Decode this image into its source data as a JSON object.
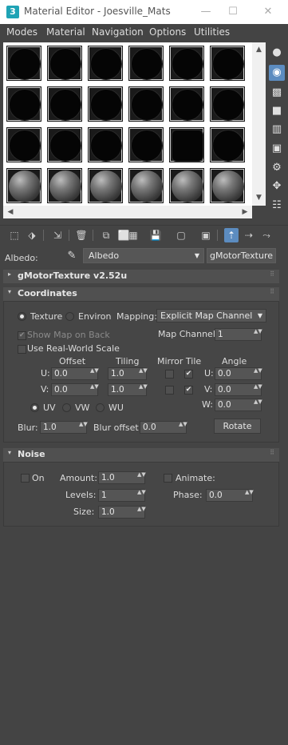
{
  "window": {
    "app_icon": "3",
    "title": "Material Editor - Joesville_Mats"
  },
  "menu": [
    "Modes",
    "Material",
    "Navigation",
    "Options",
    "Utilities"
  ],
  "slots": [
    [
      "black",
      "black",
      "black",
      "black",
      "black",
      "black"
    ],
    [
      "black",
      "black",
      "black",
      "black",
      "black",
      "black"
    ],
    [
      "black",
      "black",
      "black",
      "black",
      "black-square",
      "black"
    ],
    [
      "grey",
      "grey",
      "grey",
      "grey",
      "grey",
      "grey"
    ]
  ],
  "name_bar": {
    "label": "Albedo:",
    "material_name": "Albedo",
    "type_button": "gMotorTexture"
  },
  "rollouts": {
    "main": {
      "toggle": "▸",
      "title": "gMotorTexture v2.52u"
    },
    "coordinates": {
      "toggle": "▾",
      "title": "Coordinates",
      "texture_label": "Texture",
      "environ_label": "Environ",
      "mapping_label": "Mapping:",
      "mapping_value": "Explicit Map Channel",
      "show_map_on_back": "Show Map on Back",
      "map_channel_label": "Map Channel:",
      "map_channel_value": "1",
      "use_real_world_scale": "Use Real-World Scale",
      "col_offset": "Offset",
      "col_tiling": "Tiling",
      "col_mirror_tile": "Mirror Tile",
      "col_angle": "Angle",
      "u_label": "U:",
      "v_label": "V:",
      "w_label": "W:",
      "u_offset": "0.0",
      "v_offset": "0.0",
      "u_tiling": "1.0",
      "v_tiling": "1.0",
      "u_angle": "0.0",
      "v_angle": "0.0",
      "w_angle": "0.0",
      "uv_label": "UV",
      "vw_label": "VW",
      "wu_label": "WU",
      "blur_label": "Blur:",
      "blur_value": "1.0",
      "blur_offset_label": "Blur offset:",
      "blur_offset_value": "0.0",
      "rotate_button": "Rotate"
    },
    "noise": {
      "toggle": "▾",
      "title": "Noise",
      "on_label": "On",
      "amount_label": "Amount:",
      "amount_value": "1.0",
      "animate_label": "Animate:",
      "levels_label": "Levels:",
      "levels_value": "1",
      "phase_label": "Phase:",
      "phase_value": "0.0",
      "size_label": "Size:",
      "size_value": "1.0"
    }
  },
  "icons": {
    "close": "✕",
    "minimize": "—",
    "maximize": "☐",
    "scroll_up": "▲",
    "scroll_down": "▼",
    "scroll_left": "◀",
    "scroll_right": "▶",
    "chevron": "▼",
    "spinner": "▲▼",
    "check": "✔",
    "eyedropper": "✎",
    "grip": "⠿"
  },
  "colors": {
    "background": "#444444",
    "accent": "#5c8cc0",
    "titlebar": "#ffffff"
  }
}
